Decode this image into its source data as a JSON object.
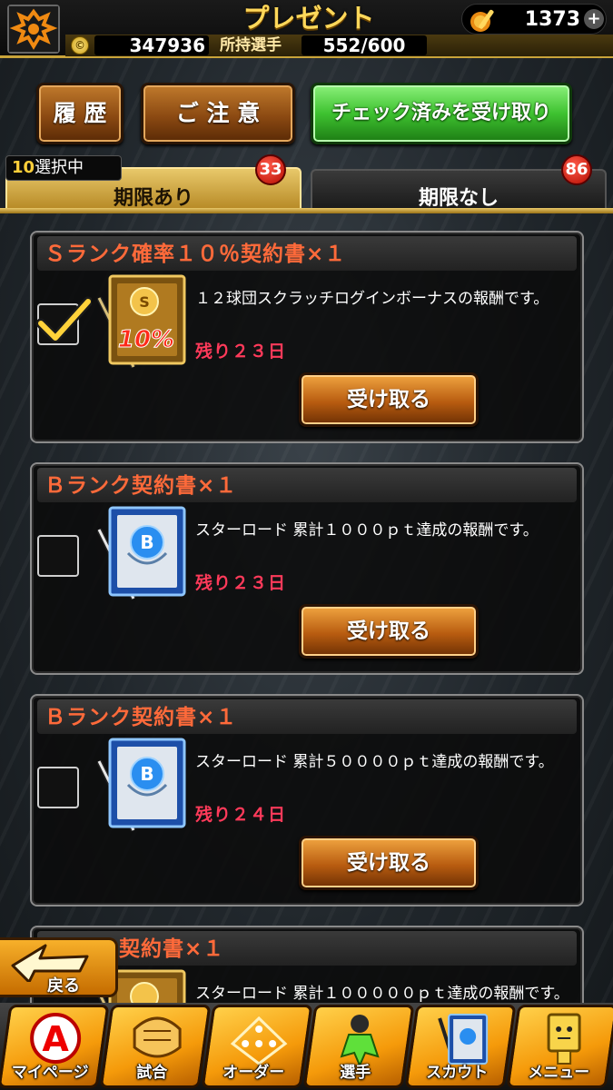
{
  "header": {
    "title": "プレゼント",
    "bat_count": "1373",
    "coins": "347936",
    "owned_label": "所持選手",
    "owned_value": "552/600"
  },
  "actions": {
    "history": "履 歴",
    "caution": "ご 注 意",
    "receive_checked": "チェック済みを受け取り"
  },
  "tabs": {
    "selected_count": "10",
    "selected_suffix": "選択中",
    "with_limit": {
      "label": "期限あり",
      "count": "33"
    },
    "no_limit": {
      "label": "期限なし",
      "count": "86"
    }
  },
  "presents": [
    {
      "title": "Ｓランク確率１０％契約書×１",
      "desc": "１２球団スクラッチログインボーナスの報酬です。",
      "remaining": "残り２３日",
      "checked": true,
      "item": "s-rank-10-contract"
    },
    {
      "title": "Ｂランク契約書×１",
      "desc": "スターロード 累計１０００ｐｔ達成の報酬です。",
      "remaining": "残り２３日",
      "checked": false,
      "item": "b-rank-contract"
    },
    {
      "title": "Ｂランク契約書×１",
      "desc": "スターロード 累計５００００ｐｔ達成の報酬です。",
      "remaining": "残り２４日",
      "checked": false,
      "item": "b-rank-contract"
    },
    {
      "title": "ド契約書×１",
      "desc": "スターロード 累計１０００００ｐｔ達成の報酬です。",
      "remaining": "",
      "checked": false,
      "item": "contract"
    }
  ],
  "receive_label": "受け取る",
  "back_label": "戻る",
  "nav": [
    {
      "label": "マイページ",
      "icon": "mypage-icon"
    },
    {
      "label": "試合",
      "icon": "match-icon"
    },
    {
      "label": "オーダー",
      "icon": "order-icon"
    },
    {
      "label": "選手",
      "icon": "player-icon"
    },
    {
      "label": "スカウト",
      "icon": "scout-icon"
    },
    {
      "label": "メニュー",
      "icon": "menu-icon"
    }
  ],
  "colors": {
    "accent_gold": "#c9a43a",
    "title_orange": "#ff6a3a",
    "remaining_red": "#ff3a5a",
    "green_button": "#3ec230"
  }
}
